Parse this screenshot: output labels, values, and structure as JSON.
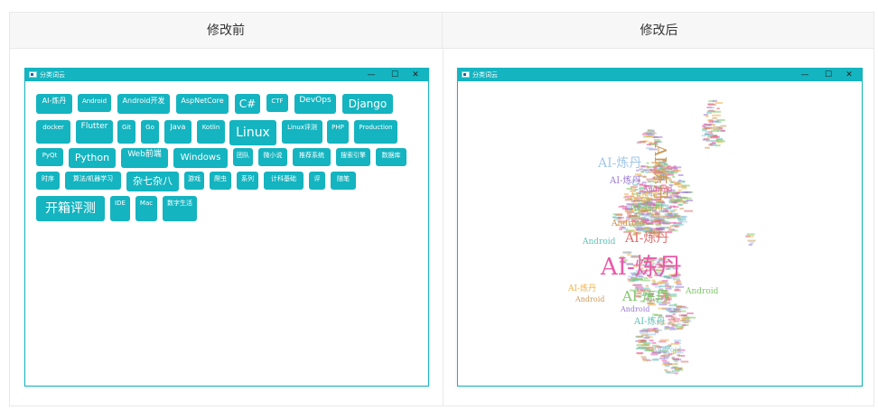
{
  "table": {
    "header_before": "修改前",
    "header_after": "修改后"
  },
  "window": {
    "title": "分类词云",
    "minimize": "—",
    "maximize": "☐",
    "close": "✕"
  },
  "tags": [
    "AI-炼丹",
    "Android",
    "Android开发",
    "AspNetCore",
    "C#",
    "CTF",
    "DevOps",
    "Django",
    "docker",
    "Flutter",
    "Git",
    "Go",
    "Java",
    "Kotlin",
    "Linux",
    "Linux评测",
    "PHP",
    "Production",
    "PyQt",
    "Python",
    "Web前端",
    "Windows",
    "团队",
    "微小说",
    "推荐系统",
    "搜索引擎",
    "数据库",
    "时序",
    "算法/机器学习",
    "杂七杂八",
    "游戏",
    "爬虫",
    "系列",
    "计科基础",
    "评",
    "随笔",
    "开箱评测",
    "IDE",
    "Mac",
    "数字生活"
  ],
  "wordcloud": {
    "words": [
      "AI-炼丹",
      "AI-炼丹",
      "AI-炼丹",
      "AI-炼丹",
      "AI-炼丹",
      "AI-炼丹",
      "AI-炼丹",
      "AI-炼丹",
      "AI-炼丹",
      "AI-炼丹",
      "Android",
      "Android",
      "Android",
      "Android",
      "Android",
      "Android",
      "Android"
    ],
    "colors": [
      "#e85aa8",
      "#7fc86a",
      "#a3c7e8",
      "#c99a5b",
      "#9b7ad1",
      "#f0b34a",
      "#62c2b5",
      "#e07070"
    ]
  }
}
